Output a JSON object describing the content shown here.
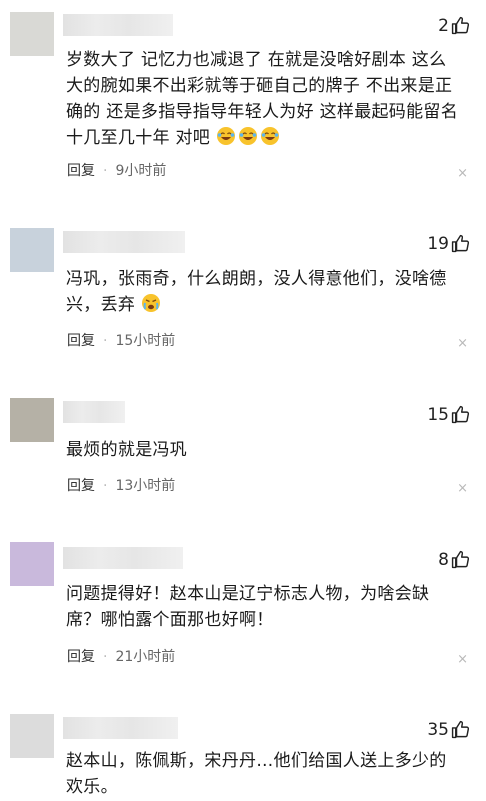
{
  "comments": [
    {
      "avatar_color": "#d9d9d5",
      "likes": "2",
      "text": "岁数大了 记忆力也减退了 在就是没啥好剧本 这么大的腕如果不出彩就等于砸自己的牌子 不出来是正确的 还是多指导指导年轻人为好 这样最起码能留名十几至几十年 对吧",
      "emoji": [
        "laughing-tears-icon",
        "laughing-tears-icon",
        "laughing-tears-icon"
      ],
      "reply_label": "回复",
      "separator": "·",
      "time": "9小时前",
      "close": "×"
    },
    {
      "avatar_color": "#c8d2dc",
      "likes": "19",
      "text": "冯巩，张雨奇，什么朗朗，没人得意他们，没啥德兴，丢弃",
      "emoji": [
        "crying-face-icon"
      ],
      "reply_label": "回复",
      "separator": "·",
      "time": "15小时前",
      "close": "×"
    },
    {
      "avatar_color": "#b5b1a6",
      "likes": "15",
      "text": "最烦的就是冯巩",
      "emoji": [],
      "reply_label": "回复",
      "separator": "·",
      "time": "13小时前",
      "close": "×"
    },
    {
      "avatar_color": "#c9b9dc",
      "likes": "8",
      "text": "问题提得好！赵本山是辽宁标志人物，为啥会缺席？哪怕露个面那也好啊！",
      "emoji": [],
      "reply_label": "回复",
      "separator": "·",
      "time": "21小时前",
      "close": "×"
    },
    {
      "avatar_color": "#dcdcdc",
      "likes": "35",
      "text": "赵本山，陈佩斯，宋丹丹…他们给国人送上多少的欢乐。",
      "emoji": [],
      "reply_label": "",
      "separator": "",
      "time": "",
      "close": ""
    }
  ]
}
